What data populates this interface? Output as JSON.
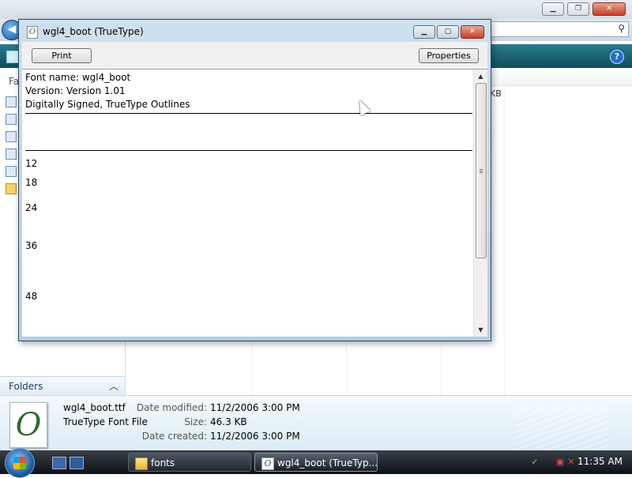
{
  "explorer": {
    "nav": {
      "favorites_label": "Fa",
      "folders_label": "Folders"
    },
    "kb_fragment": "KB",
    "details": {
      "file_name": "wgl4_boot.ttf",
      "file_type": "TrueType Font File",
      "date_modified_label": "Date modified:",
      "date_modified": "11/2/2006 3:00 PM",
      "size_label": "Size:",
      "size": "46.3 KB",
      "date_created_label": "Date created:",
      "date_created": "11/2/2006 3:00 PM"
    }
  },
  "font_viewer": {
    "title": "wgl4_boot (TrueType)",
    "print_label": "Print",
    "properties_label": "Properties",
    "font_name_line": "Font name: wgl4_boot",
    "version_line": "Version: Version 1.01",
    "signed_line": "Digitally Signed, TrueType Outlines",
    "sizes": [
      "12",
      "18",
      "24",
      "36",
      "48"
    ]
  },
  "taskbar": {
    "tasks": [
      {
        "label": "fonts",
        "active": false
      },
      {
        "label": "wgl4_boot (TrueTyp...",
        "active": true
      }
    ],
    "clock": "11:35 AM"
  }
}
